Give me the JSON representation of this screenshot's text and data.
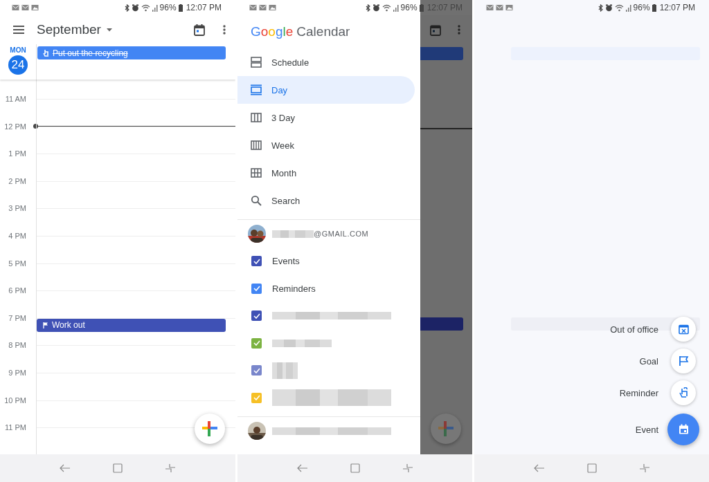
{
  "day_view": {
    "status_bar": {
      "battery": "96%",
      "time": "12:07 PM"
    },
    "app_bar": {
      "title": "September"
    },
    "day": {
      "weekday": "MON",
      "date": "24"
    },
    "all_day_events": [
      {
        "title": "Put out the recycling",
        "kind": "reminder",
        "done": true,
        "color": "#4285f4"
      }
    ],
    "hours": [
      {
        "label": "11 AM",
        "now": false
      },
      {
        "label": "12 PM",
        "now": true
      },
      {
        "label": "1 PM",
        "now": false
      },
      {
        "label": "2 PM",
        "now": false
      },
      {
        "label": "3 PM",
        "now": false
      },
      {
        "label": "4 PM",
        "now": false
      },
      {
        "label": "5 PM",
        "now": false
      },
      {
        "label": "6 PM",
        "now": false
      },
      {
        "label": "7 PM",
        "now": false,
        "events": [
          {
            "title": "Work out",
            "kind": "goal",
            "done": false,
            "color": "#3f51b5"
          }
        ]
      },
      {
        "label": "8 PM",
        "now": false
      },
      {
        "label": "9 PM",
        "now": false
      },
      {
        "label": "10 PM",
        "now": false
      },
      {
        "label": "11 PM",
        "now": false
      }
    ]
  },
  "drawer": {
    "status_bar": {
      "battery": "96%",
      "time": "12:07 PM"
    },
    "logo_word": "Google",
    "title": "Calendar",
    "views": [
      {
        "label": "Schedule",
        "selected": false
      },
      {
        "label": "Day",
        "selected": true
      },
      {
        "label": "3 Day",
        "selected": false
      },
      {
        "label": "Week",
        "selected": false
      },
      {
        "label": "Month",
        "selected": false
      },
      {
        "label": "Search",
        "selected": false
      }
    ],
    "accounts": [
      {
        "kind": "partial",
        "email": "@GMAIL.COM",
        "calendars": [
          {
            "kind": "named",
            "label": "Events",
            "checked": true,
            "color": "#3f51b5"
          },
          {
            "kind": "named",
            "label": "Reminders",
            "checked": true,
            "color": "#4285f4"
          },
          {
            "kind": "redacted",
            "checked": true,
            "color": "#3f51b5"
          },
          {
            "kind": "redacted",
            "checked": true,
            "color": "#7cb342"
          },
          {
            "kind": "redacted",
            "checked": true,
            "color": "#7986cb"
          },
          {
            "kind": "redacted",
            "checked": true,
            "color": "#f6c026"
          }
        ]
      },
      {
        "kind": "redacted"
      }
    ]
  },
  "create_menu": {
    "status_bar": {
      "battery": "96%",
      "time": "12:07 PM"
    },
    "items": [
      {
        "label": "Out of office",
        "kind": "mini"
      },
      {
        "label": "Goal",
        "kind": "mini"
      },
      {
        "label": "Reminder",
        "kind": "mini"
      },
      {
        "label": "Event",
        "kind": "primary"
      }
    ]
  }
}
